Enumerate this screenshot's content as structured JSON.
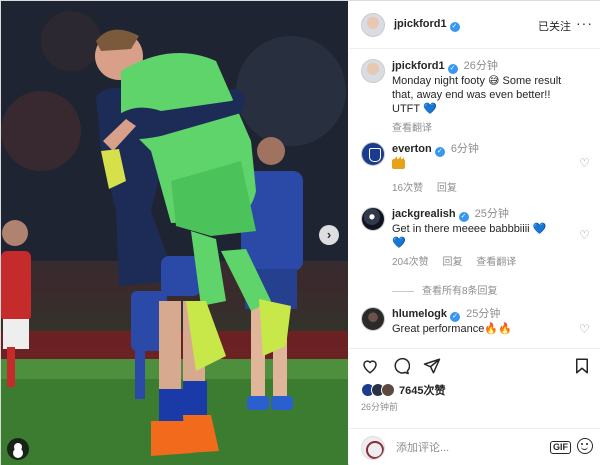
{
  "post": {
    "username": "jpickford1",
    "follow_label": "已关注",
    "more_label": "···"
  },
  "caption": {
    "username": "jpickford1",
    "time": "26分钟",
    "text_line1": "Monday night footy 😅 Some result",
    "text_line2": "that, away end was even better!!",
    "text_line3": "UTFT",
    "text_emoji": "💙",
    "translate": "查看翻译"
  },
  "comments": [
    {
      "username": "everton",
      "time": "6分钟",
      "text": "",
      "likes": "16次赞",
      "reply": "回复"
    },
    {
      "username": "jackgrealish",
      "time": "25分钟",
      "text": "Get in there meeee babbbiiii",
      "emoji": "💙",
      "likes": "204次赞",
      "reply": "回复",
      "translate": "查看翻译"
    },
    {
      "username": "hlumelogk",
      "time": "25分钟",
      "text": "Great performance",
      "emoji": "🔥🔥"
    }
  ],
  "view_replies": "查看所有8条回复",
  "actions": {
    "like_icon": "heart-icon",
    "comment_icon": "comment-icon",
    "share_icon": "send-icon",
    "save_icon": "bookmark-icon"
  },
  "likes_count": "7645次赞",
  "posted_ago": "26分钟前",
  "add_comment_placeholder": "添加评论...",
  "gif_label": "GIF",
  "colors": {
    "verified": "#3897f0",
    "keeper_kit": "#5fd46a",
    "everton_blue": "#1b3b8f"
  }
}
